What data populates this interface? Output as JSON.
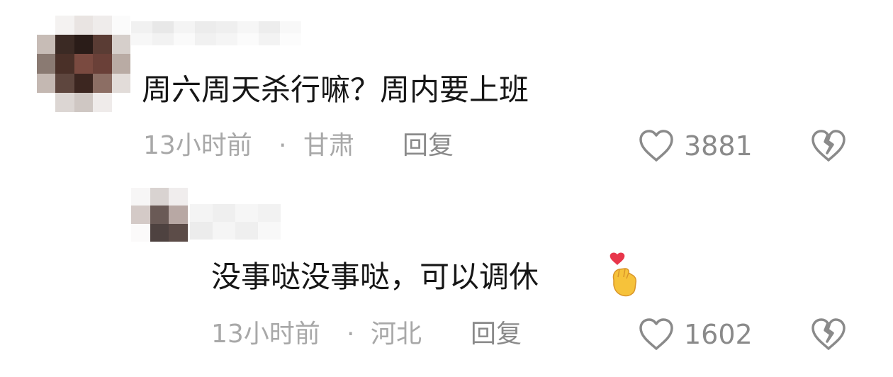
{
  "comments": [
    {
      "text": "周六周天杀行嘛？周内要上班",
      "time": "13小时前",
      "separator": "·",
      "location": "甘肃",
      "reply_label": "回复",
      "like_count": "3881",
      "like_icon": "heart-outline-icon",
      "dislike_icon": "broken-heart-icon"
    },
    {
      "text": "没事哒没事哒，可以调休",
      "emoji": "🫰",
      "emoji_icon": "finger-heart-emoji",
      "time": "13小时前",
      "separator": "·",
      "location": "河北",
      "reply_label": "回复",
      "like_count": "1602",
      "like_icon": "heart-outline-icon",
      "dislike_icon": "broken-heart-icon"
    }
  ],
  "colors": {
    "text": "#161616",
    "meta": "#a8a8a8",
    "secondary": "#8a8a8a",
    "heart_red": "#e8364b",
    "emoji_yellow": "#f6c23a"
  }
}
